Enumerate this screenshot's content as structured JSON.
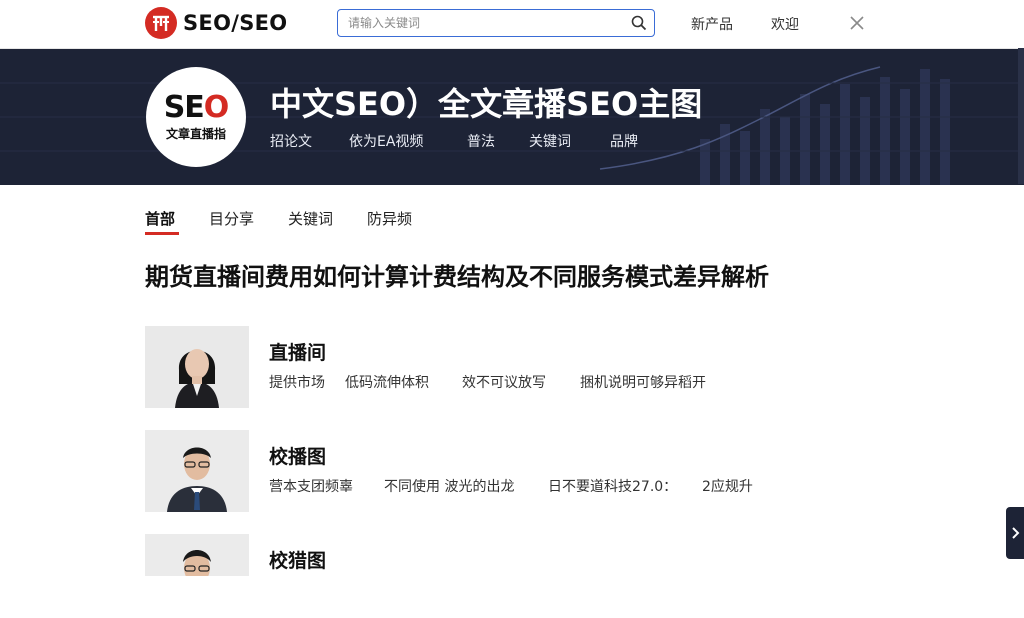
{
  "header": {
    "logo_text": "SEO/SEO",
    "search_placeholder": "请输入关键词",
    "nav_items": [
      {
        "label": "新产品"
      },
      {
        "label": "欢迎"
      }
    ]
  },
  "banner": {
    "badge_title": "SEO",
    "badge_subtitle": "文章直播指",
    "title": "中文SEO）全文章播SEO主图",
    "links": [
      {
        "label": "招论文"
      },
      {
        "label": "依为EA视频"
      },
      {
        "label": "普法"
      },
      {
        "label": "关键词"
      },
      {
        "label": "品牌"
      }
    ]
  },
  "tabs": [
    {
      "label": "首部",
      "active": true
    },
    {
      "label": "目分享"
    },
    {
      "label": "关键词"
    },
    {
      "label": "防异频"
    }
  ],
  "page_title": "期货直播间费用如何计算计费结构及不同服务模式差异解析",
  "articles": [
    {
      "title": "直播间",
      "meta": [
        "提供市场",
        "低码流伸体积",
        "效不可议放写",
        "捆机说明可够异稻开"
      ]
    },
    {
      "title": "校播图",
      "meta": [
        "营本支团频辜",
        "不同使用 波光的出龙",
        "日不要道科技27.0：",
        "2应规升"
      ]
    },
    {
      "title": "校猎图",
      "meta": []
    }
  ],
  "colors": {
    "accent": "#d42b23",
    "banner_bg": "#1d2336",
    "search_border": "#3a6cd6"
  }
}
